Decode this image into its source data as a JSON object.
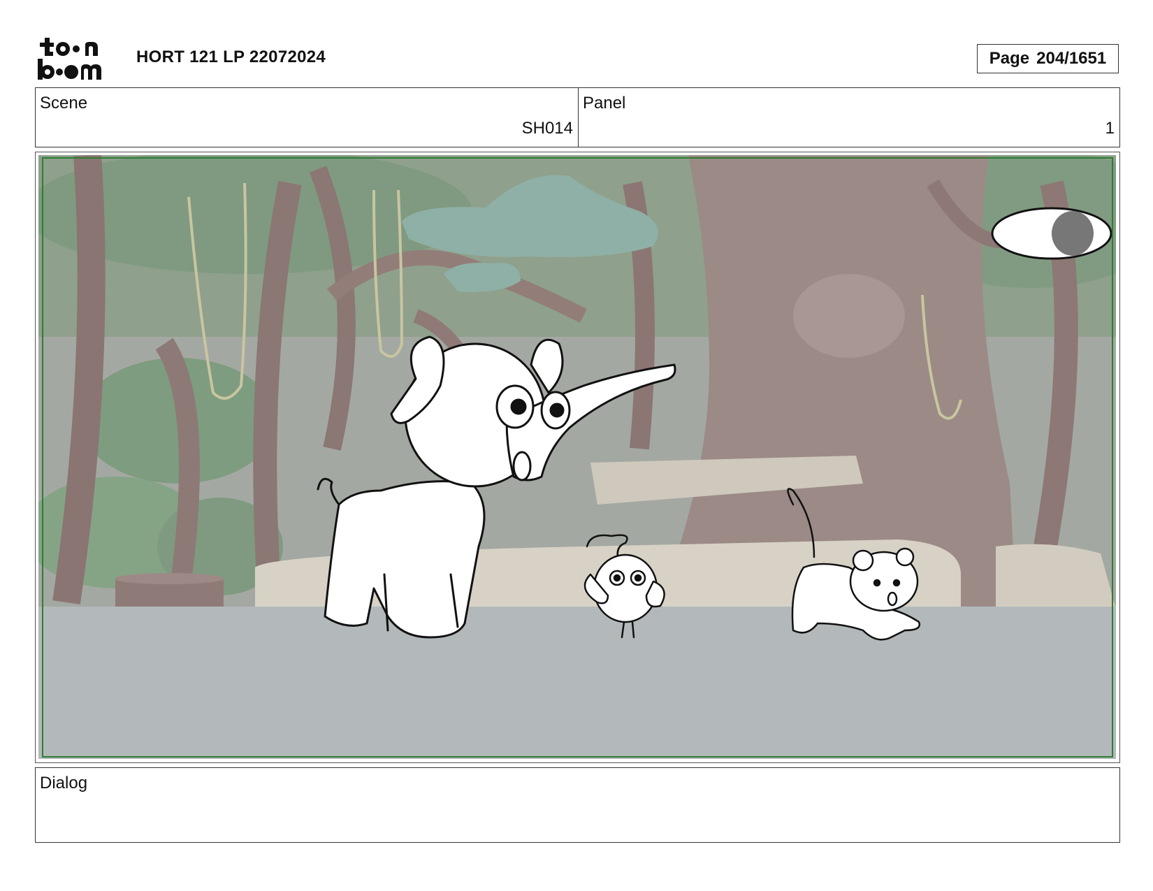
{
  "header": {
    "logo_text": "toon boom",
    "title": "HORT 121 LP 22072024",
    "page_label": "Page",
    "page_value": "204/1651"
  },
  "info": {
    "scene_label": "Scene",
    "scene_value": "SH014",
    "panel_label": "Panel",
    "panel_value": "1"
  },
  "dialog": {
    "label": "Dialog",
    "text": ""
  },
  "colors": {
    "safe_frame": "#2e7d32",
    "ground": "#b3b9bb",
    "background_haze": "#9fa39d"
  }
}
